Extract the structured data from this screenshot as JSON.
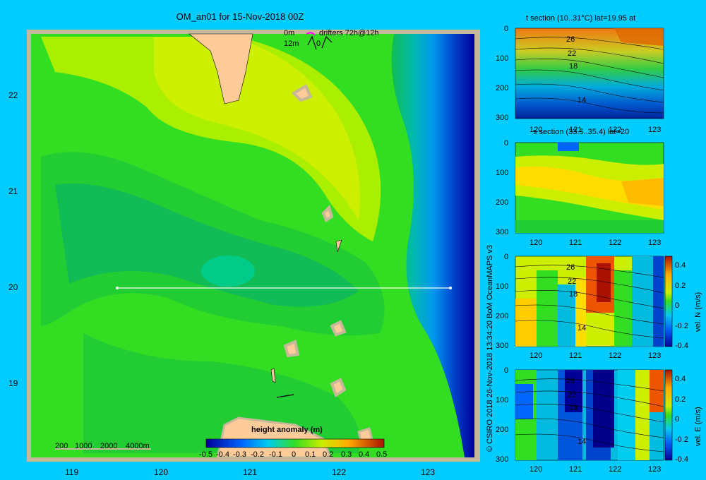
{
  "main_title": "OM_an01 for 15-Nov-2018 00Z",
  "map": {
    "x_ticks": [
      "119",
      "120",
      "121",
      "122",
      "123"
    ],
    "y_ticks": [
      "22",
      "21",
      "20",
      "19"
    ],
    "legend_top": {
      "row1_depth": "0m",
      "row1_text": "drifters 72h@12h",
      "row2_depth": "12m",
      "row2_text": "0"
    },
    "depth_legend": [
      "200",
      "1000",
      "2000",
      "4000m"
    ],
    "colorbar": {
      "title": "height anomaly (m)",
      "ticks": [
        "-0.5",
        "-0.4",
        "-0.3",
        "-0.2",
        "-0.1",
        "0",
        "0.1",
        "0.2",
        "0.3",
        "0.4",
        "0.5"
      ]
    }
  },
  "credit": "© CSIRO 2018   26-Nov-2018 13:34:20 BoM OceanMAPS v3",
  "panels": [
    {
      "title": "t section (10..31°C) lat=19.95 at",
      "x_ticks": [
        "120",
        "121",
        "122",
        "123"
      ],
      "y_ticks": [
        "0",
        "100",
        "200",
        "300"
      ],
      "contours": [
        "26",
        "22",
        "18",
        "14"
      ]
    },
    {
      "title": "s section (33.5..35.4) lat=20",
      "x_ticks": [
        "120",
        "121",
        "122",
        "123"
      ],
      "y_ticks": [
        "0",
        "100",
        "200",
        "300"
      ]
    },
    {
      "title": "",
      "x_ticks": [
        "120",
        "121",
        "122",
        "123"
      ],
      "y_ticks": [
        "0",
        "100",
        "200",
        "300"
      ],
      "contours": [
        "26",
        "22",
        "18",
        "14"
      ],
      "cbar_ticks": [
        "0.4",
        "0.2",
        "0",
        "-0.2",
        "-0.4"
      ],
      "cbar_label": "vel. N (m/s)"
    },
    {
      "title": "",
      "x_ticks": [
        "120",
        "121",
        "122",
        "123"
      ],
      "y_ticks": [
        "0",
        "100",
        "200",
        "300"
      ],
      "contours": [
        "26",
        "22",
        "18",
        "14"
      ],
      "cbar_ticks": [
        "0.4",
        "0.2",
        "0",
        "-0.2",
        "-0.4"
      ],
      "cbar_label": "vel. E (m/s)"
    }
  ],
  "colors": {
    "background": "#00ccff",
    "land": "#ffcc99",
    "map_green": "#33dd22",
    "map_yellowgreen": "#aaee00",
    "map_darkgreen": "#11bb55",
    "deep_blue": "#000099"
  }
}
